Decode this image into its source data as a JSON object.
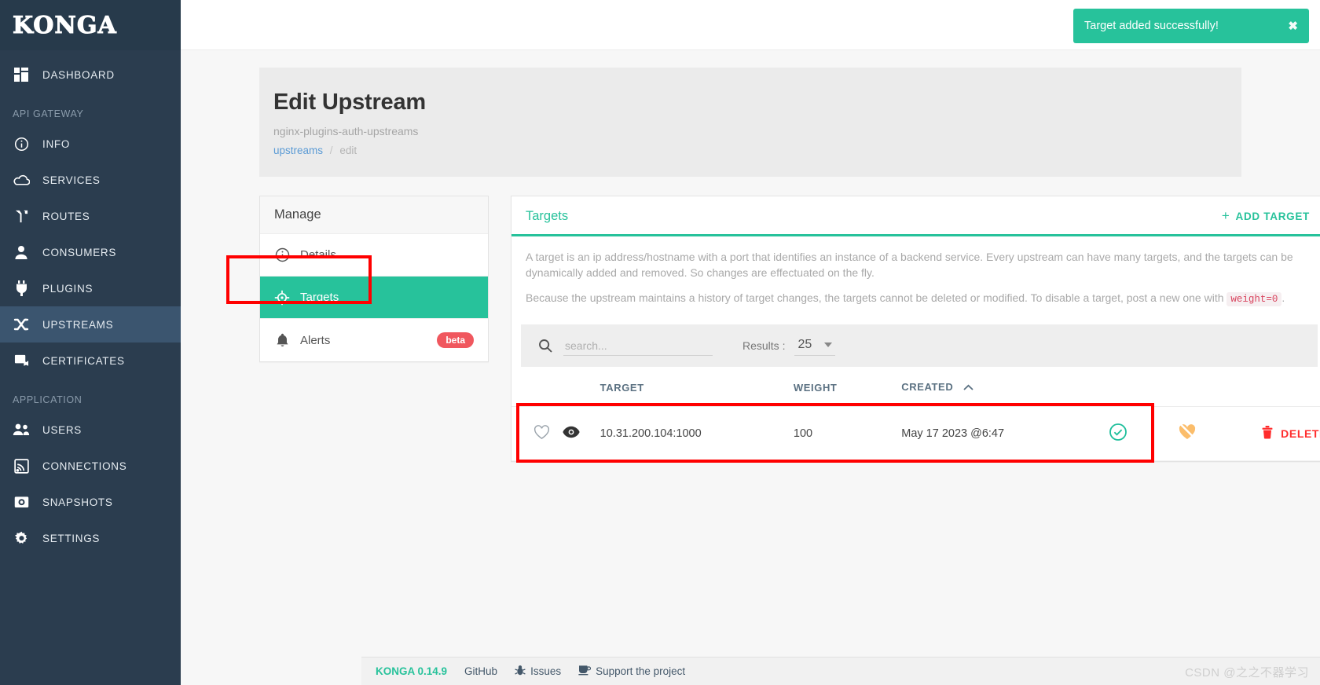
{
  "brand": {
    "name": "KONGA"
  },
  "sidebar": {
    "top_items": [
      {
        "label": "DASHBOARD",
        "icon": "dashboard-icon",
        "active": false
      }
    ],
    "sections": [
      {
        "title": "API GATEWAY",
        "items": [
          {
            "label": "INFO",
            "icon": "info-icon",
            "active": false
          },
          {
            "label": "SERVICES",
            "icon": "cloud-icon",
            "active": false
          },
          {
            "label": "ROUTES",
            "icon": "routes-icon",
            "active": false
          },
          {
            "label": "CONSUMERS",
            "icon": "user-icon",
            "active": false
          },
          {
            "label": "PLUGINS",
            "icon": "plug-icon",
            "active": false
          },
          {
            "label": "UPSTREAMS",
            "icon": "shuffle-icon",
            "active": true
          },
          {
            "label": "CERTIFICATES",
            "icon": "certificate-icon",
            "active": false
          }
        ]
      },
      {
        "title": "APPLICATION",
        "items": [
          {
            "label": "USERS",
            "icon": "users-icon",
            "active": false
          },
          {
            "label": "CONNECTIONS",
            "icon": "connections-icon",
            "active": false
          },
          {
            "label": "SNAPSHOTS",
            "icon": "camera-icon",
            "active": false
          },
          {
            "label": "SETTINGS",
            "icon": "gear-icon",
            "active": false
          }
        ]
      }
    ]
  },
  "toast": {
    "message": "Target added successfully!",
    "close_label": "✖",
    "color": "#27c29b"
  },
  "page": {
    "title": "Edit Upstream",
    "subtitle": "nginx-plugins-auth-upstreams",
    "breadcrumb_link": "upstreams",
    "breadcrumb_sep": "/",
    "breadcrumb_current": "edit"
  },
  "manage": {
    "header": "Manage",
    "items": [
      {
        "label": "Details",
        "icon": "info-circle-icon",
        "active": false,
        "badge": ""
      },
      {
        "label": "Targets",
        "icon": "crosshair-icon",
        "active": true,
        "badge": ""
      },
      {
        "label": "Alerts",
        "icon": "bell-icon",
        "active": false,
        "badge": "beta"
      }
    ]
  },
  "targets": {
    "title": "Targets",
    "add_button": "ADD TARGET",
    "add_plus": "+",
    "description_1": "A target is an ip address/hostname with a port that identifies an instance of a backend service. Every upstream can have many targets, and the targets can be dynamically added and removed. So changes are effectuated on the fly.",
    "description_2_pre": "Because the upstream maintains a history of target changes, the targets cannot be deleted or modified. To disable a target, post a new one with",
    "description_2_code": "weight=0",
    "description_2_post": ".",
    "search_placeholder": "search...",
    "search_value": "",
    "results_label": "Results :",
    "results_value": "25",
    "columns": [
      "",
      "",
      "TARGET",
      "WEIGHT",
      "CREATED",
      "",
      "",
      ""
    ],
    "sort_column": "CREATED",
    "sort_direction": "asc",
    "rows": [
      {
        "target": "10.31.200.104:1000",
        "weight": "100",
        "created": "May 17 2023 @6:47",
        "favorite_icon": "heart-outline-icon",
        "view_icon": "eye-icon",
        "status_icon": "check-circle-icon",
        "health_icon": "health-off-icon",
        "delete_label": "DELETE",
        "delete_icon": "trash-icon"
      }
    ]
  },
  "footer": {
    "version": "KONGA 0.14.9",
    "links": [
      {
        "label": "GitHub",
        "icon": ""
      },
      {
        "label": "Issues",
        "icon": "bug-icon"
      },
      {
        "label": "Support the project",
        "icon": "coffee-icon"
      }
    ],
    "watermark": "CSDN @之之不器学习"
  },
  "colors": {
    "accent": "#27c29b",
    "sidebar": "#2b3d4f",
    "danger": "#ff2d2d",
    "annotation": "#ff0000"
  }
}
